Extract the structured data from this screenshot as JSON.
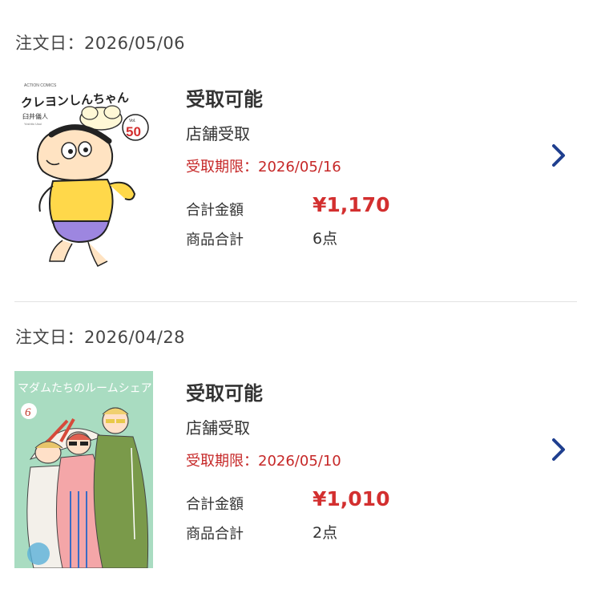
{
  "orders": [
    {
      "date_label": "注文日：2026/05/06",
      "cover": {
        "publisher": "ACTION COMICS",
        "title": "クレヨンしんちゃん",
        "author": "臼井儀人",
        "author_romaji": "Yoshito Usui",
        "volume_prefix": "Vol.",
        "volume": "50"
      },
      "status": "受取可能",
      "method": "店舗受取",
      "deadline": "受取期限：2026/05/16",
      "total_label": "合計金額",
      "total_value": "¥1,170",
      "count_label": "商品合計",
      "count_value": "6点",
      "chevron_icon": "chevron-right-icon"
    },
    {
      "date_label": "注文日：2026/04/28",
      "cover": {
        "title": "マダムたちのルームシェア",
        "volume": "6"
      },
      "status": "受取可能",
      "method": "店舗受取",
      "deadline": "受取期限：2026/05/10",
      "total_label": "合計金額",
      "total_value": "¥1,010",
      "count_label": "商品合計",
      "count_value": "2点",
      "chevron_icon": "chevron-right-icon"
    }
  ],
  "colors": {
    "accent_price": "#d32f2f",
    "deadline": "#c62828",
    "chevron": "#1f3f8f",
    "divider": "#e2e2e2"
  }
}
